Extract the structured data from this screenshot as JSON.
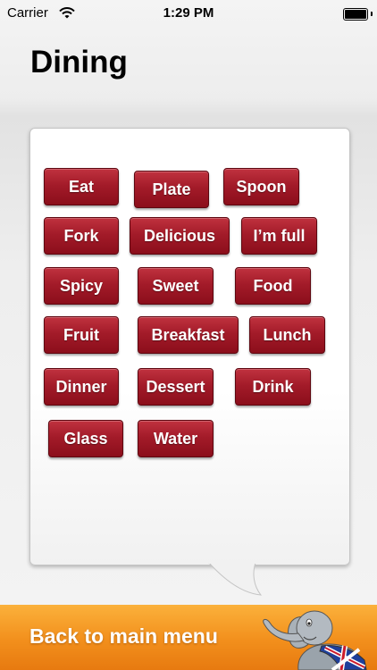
{
  "status_bar": {
    "carrier": "Carrier",
    "time": "1:29 PM"
  },
  "page": {
    "title": "Dining"
  },
  "words": [
    {
      "label": "Eat"
    },
    {
      "label": "Plate"
    },
    {
      "label": "Spoon"
    },
    {
      "label": "Fork"
    },
    {
      "label": "Delicious"
    },
    {
      "label": "I’m full"
    },
    {
      "label": "Spicy"
    },
    {
      "label": "Sweet"
    },
    {
      "label": "Food"
    },
    {
      "label": "Fruit"
    },
    {
      "label": "Breakfast"
    },
    {
      "label": "Lunch"
    },
    {
      "label": "Dinner"
    },
    {
      "label": "Dessert"
    },
    {
      "label": "Drink"
    },
    {
      "label": "Glass"
    },
    {
      "label": "Water"
    }
  ],
  "footer": {
    "back_label": "Back to main menu"
  },
  "icons": {
    "wifi": "wifi-icon",
    "battery": "battery-icon",
    "mascot": "elephant-mascot-icon"
  },
  "colors": {
    "button": "#a31b29",
    "footer": "#f28f1c"
  }
}
